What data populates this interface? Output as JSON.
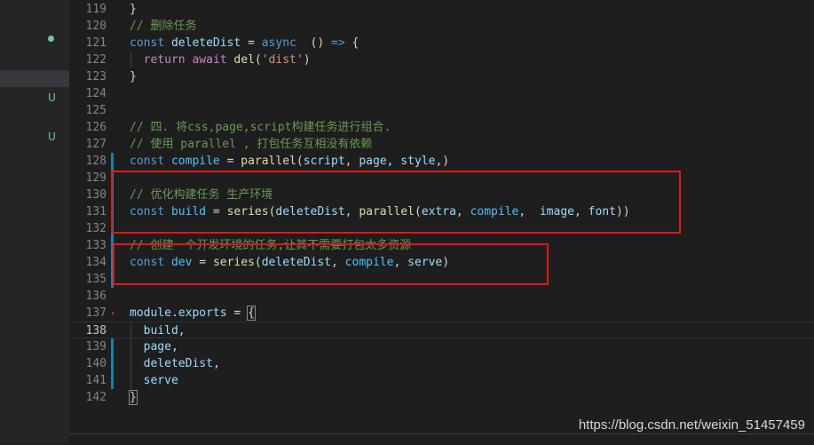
{
  "explorer": {
    "rows": [
      {
        "status": "dot",
        "selected": false
      },
      {
        "status": "",
        "selected": true
      },
      {
        "status": "U",
        "selected": false
      },
      {
        "status": "U",
        "selected": false
      }
    ]
  },
  "editor": {
    "lines": [
      {
        "n": "119",
        "tokens": [
          [
            "}",
            ""
          ]
        ]
      },
      {
        "n": "120",
        "tokens": [
          [
            "// 删除任务",
            "cmt"
          ]
        ]
      },
      {
        "n": "121",
        "tokens": [
          [
            "const ",
            "kw"
          ],
          [
            "deleteDist",
            "var"
          ],
          [
            " = ",
            ""
          ],
          [
            "async",
            "kw"
          ],
          [
            "  () ",
            ""
          ],
          [
            "=>",
            "kw"
          ],
          [
            " {",
            ""
          ]
        ]
      },
      {
        "n": "122",
        "indent": true,
        "tokens": [
          [
            "  ",
            ""
          ],
          [
            "return",
            "ctl"
          ],
          [
            " ",
            ""
          ],
          [
            "await",
            "ctl"
          ],
          [
            " ",
            ""
          ],
          [
            "del",
            "fn"
          ],
          [
            "(",
            ""
          ],
          [
            "'dist'",
            "str"
          ],
          [
            ")",
            ""
          ]
        ]
      },
      {
        "n": "123",
        "tokens": [
          [
            "}",
            ""
          ]
        ]
      },
      {
        "n": "124",
        "tokens": []
      },
      {
        "n": "125",
        "tokens": []
      },
      {
        "n": "126",
        "tokens": [
          [
            "// 四. 将css,page,script构建任务进行组合.",
            "cmt"
          ]
        ]
      },
      {
        "n": "127",
        "tokens": [
          [
            "// 使用 parallel , 打包任务互相没有依赖",
            "cmt"
          ]
        ]
      },
      {
        "n": "128",
        "bar": true,
        "tokens": [
          [
            "const ",
            "kw"
          ],
          [
            "compile",
            "cst"
          ],
          [
            " = ",
            ""
          ],
          [
            "parallel",
            "fn"
          ],
          [
            "(",
            ""
          ],
          [
            "script",
            "var"
          ],
          [
            ", ",
            ""
          ],
          [
            "page",
            "var"
          ],
          [
            ", ",
            ""
          ],
          [
            "style",
            "var"
          ],
          [
            ",)",
            ""
          ]
        ]
      },
      {
        "n": "129",
        "bar": true,
        "tokens": []
      },
      {
        "n": "130",
        "bar": true,
        "tokens": [
          [
            "// 优化构建任务 生产环境",
            "cmt"
          ]
        ]
      },
      {
        "n": "131",
        "bar": true,
        "tokens": [
          [
            "const ",
            "kw"
          ],
          [
            "build",
            "cst"
          ],
          [
            " = ",
            ""
          ],
          [
            "series",
            "fn"
          ],
          [
            "(",
            ""
          ],
          [
            "deleteDist",
            "var"
          ],
          [
            ", ",
            ""
          ],
          [
            "parallel",
            "fn"
          ],
          [
            "(",
            ""
          ],
          [
            "extra",
            "var"
          ],
          [
            ", ",
            ""
          ],
          [
            "compile",
            "cst"
          ],
          [
            ",  ",
            ""
          ],
          [
            "image",
            "var"
          ],
          [
            ", ",
            ""
          ],
          [
            "font",
            "var"
          ],
          [
            "))",
            ""
          ]
        ]
      },
      {
        "n": "132",
        "bar": true,
        "tokens": []
      },
      {
        "n": "133",
        "bar": true,
        "tokens": [
          [
            "// 创建一个开发环境的任务,让其不需要打包太多资源",
            "cmt"
          ]
        ]
      },
      {
        "n": "134",
        "bar": true,
        "tokens": [
          [
            "const ",
            "kw"
          ],
          [
            "dev",
            "cst"
          ],
          [
            " = ",
            ""
          ],
          [
            "series",
            "fn"
          ],
          [
            "(",
            ""
          ],
          [
            "deleteDist",
            "var"
          ],
          [
            ", ",
            ""
          ],
          [
            "compile",
            "cst"
          ],
          [
            ", ",
            ""
          ],
          [
            "serve",
            "var"
          ],
          [
            ")",
            ""
          ]
        ]
      },
      {
        "n": "135",
        "bar": true,
        "tokens": []
      },
      {
        "n": "136",
        "tokens": []
      },
      {
        "n": "137",
        "fold": true,
        "tokens": [
          [
            "module",
            "var"
          ],
          [
            ".",
            ""
          ],
          [
            "exports",
            "var"
          ],
          [
            " = ",
            ""
          ],
          [
            "{",
            "brk"
          ]
        ]
      },
      {
        "n": "138",
        "current": true,
        "indent": true,
        "tokens": [
          [
            "  ",
            ""
          ],
          [
            "build",
            "var"
          ],
          [
            ",",
            ""
          ]
        ]
      },
      {
        "n": "139",
        "bar": true,
        "indent": true,
        "tokens": [
          [
            "  ",
            ""
          ],
          [
            "page",
            "var"
          ],
          [
            ",",
            ""
          ]
        ]
      },
      {
        "n": "140",
        "bar": true,
        "indent": true,
        "tokens": [
          [
            "  ",
            ""
          ],
          [
            "deleteDist",
            "var"
          ],
          [
            ",",
            ""
          ]
        ]
      },
      {
        "n": "141",
        "bar": true,
        "indent": true,
        "tokens": [
          [
            "  ",
            ""
          ],
          [
            "serve",
            "var"
          ],
          [
            "",
            ""
          ]
        ]
      },
      {
        "n": "142",
        "tokens": [
          [
            "}",
            "brk"
          ]
        ]
      }
    ]
  },
  "watermark": "https://blog.csdn.net/weixin_51457459",
  "colors": {
    "background": "#1e1e1e",
    "sidebar": "#252526",
    "highlight_box": "#e01818",
    "git_bar": "#1b81a8"
  }
}
